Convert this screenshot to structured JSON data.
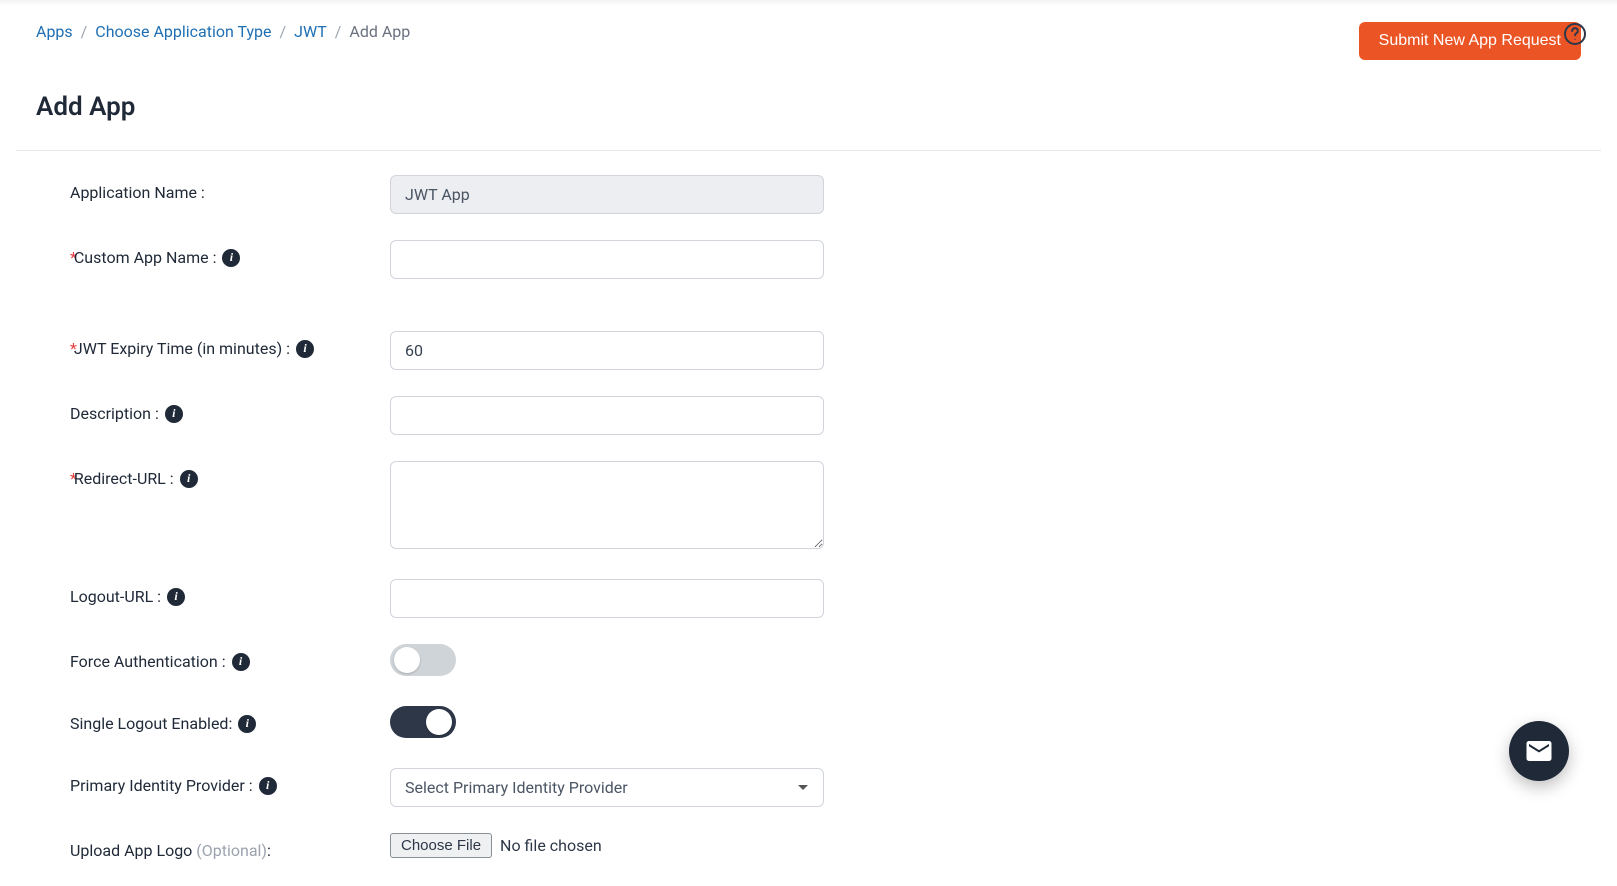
{
  "breadcrumb": {
    "items": [
      {
        "label": "Apps"
      },
      {
        "label": "Choose Application Type"
      },
      {
        "label": "JWT"
      }
    ],
    "current": "Add App"
  },
  "header": {
    "submit_button": "Submit New App Request"
  },
  "page_title": "Add App",
  "form": {
    "app_name_label": "Application Name :",
    "app_name_value": "JWT App",
    "custom_app_name_label": "Custom App Name :",
    "custom_app_name_value": "",
    "jwt_expiry_label": "JWT Expiry Time (in minutes) :",
    "jwt_expiry_value": "60",
    "description_label": "Description :",
    "description_value": "",
    "redirect_url_label": "Redirect-URL :",
    "redirect_url_value": "",
    "logout_url_label": "Logout-URL :",
    "logout_url_value": "",
    "force_auth_label": "Force Authentication :",
    "force_auth_on": false,
    "single_logout_label": "Single Logout Enabled:",
    "single_logout_on": true,
    "primary_idp_label": "Primary Identity Provider :",
    "primary_idp_placeholder": "Select Primary Identity Provider",
    "upload_logo_label": "Upload App Logo ",
    "upload_logo_optional": "(Optional)",
    "upload_logo_colon": ":",
    "choose_file_btn": "Choose File",
    "file_status": "No file chosen"
  }
}
